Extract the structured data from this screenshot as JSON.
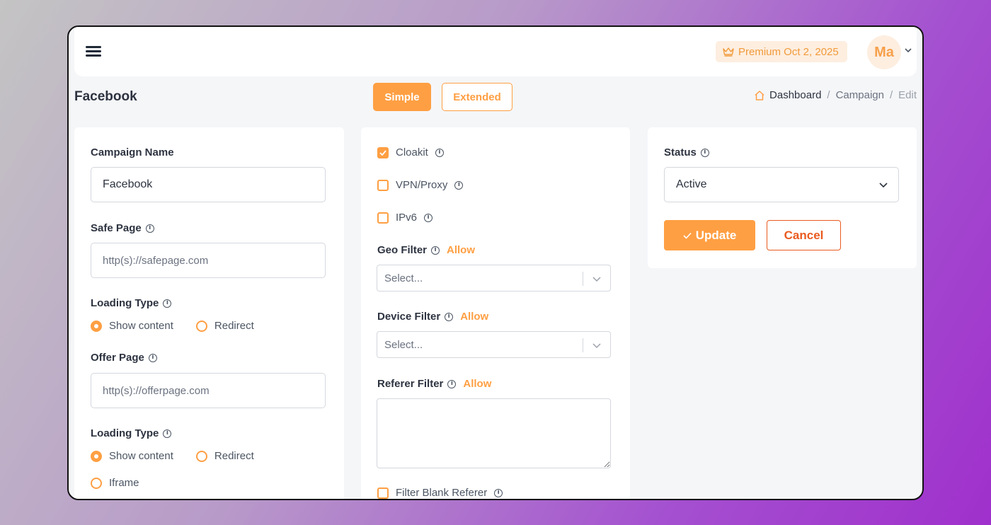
{
  "header": {
    "premium_label": "Premium Oct 2, 2025",
    "avatar_initials": "Ma"
  },
  "page": {
    "title": "Facebook",
    "mode_tabs": {
      "simple": "Simple",
      "extended": "Extended"
    },
    "breadcrumb": {
      "home": "Dashboard",
      "sep": "/",
      "section": "Campaign",
      "current": "Edit"
    }
  },
  "left_card": {
    "campaign_name_label": "Campaign Name",
    "campaign_name_value": "Facebook",
    "safe_page_label": "Safe Page",
    "safe_page_placeholder": "http(s)://safepage.com",
    "loading_type_label_1": "Loading Type",
    "loading_type_1_options": [
      "Show content",
      "Redirect"
    ],
    "offer_page_label": "Offer Page",
    "offer_page_placeholder": "http(s)://offerpage.com",
    "loading_type_label_2": "Loading Type",
    "loading_type_2_options": [
      "Show content",
      "Redirect",
      "Iframe"
    ]
  },
  "middle_card": {
    "checkboxes": [
      {
        "label": "Cloakit",
        "checked": true
      },
      {
        "label": "VPN/Proxy",
        "checked": false
      },
      {
        "label": "IPv6",
        "checked": false
      }
    ],
    "geo_filter_label": "Geo Filter",
    "geo_filter_mode": "Allow",
    "geo_filter_placeholder": "Select...",
    "device_filter_label": "Device Filter",
    "device_filter_mode": "Allow",
    "device_filter_placeholder": "Select...",
    "referer_filter_label": "Referer Filter",
    "referer_filter_mode": "Allow",
    "filter_blank_referer_label": "Filter Blank Referer",
    "filter_blank_referer_checked": false
  },
  "right_card": {
    "status_label": "Status",
    "status_value": "Active",
    "update_label": "Update",
    "cancel_label": "Cancel"
  },
  "colors": {
    "accent": "#ff9f43",
    "cancel": "#ea5a1f",
    "text": "#2d3340"
  },
  "icons": {
    "menu": "hamburger-icon",
    "premium": "crown-icon",
    "home": "home-icon",
    "info": "info-icon",
    "check": "check-icon",
    "chevron": "chevron-down-icon"
  }
}
